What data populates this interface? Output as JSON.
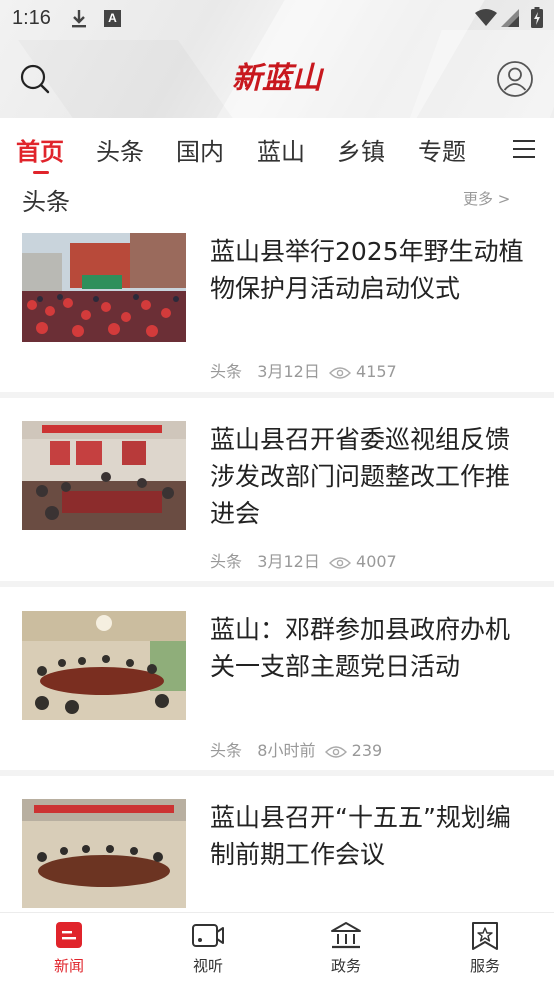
{
  "status_bar": {
    "time": "1:16",
    "a_badge": "A"
  },
  "header": {
    "logo_text": "新蓝山"
  },
  "tabs": [
    {
      "label": "首页",
      "active": true
    },
    {
      "label": "头条"
    },
    {
      "label": "国内"
    },
    {
      "label": "蓝山"
    },
    {
      "label": "乡镇"
    },
    {
      "label": "专题"
    }
  ],
  "section": {
    "title": "头条",
    "more": "更多 >"
  },
  "news": [
    {
      "title": "蓝山县举行2025年野生动植物保护月活动启动仪式",
      "category": "头条",
      "date": "3月12日",
      "views": "4157"
    },
    {
      "title": "蓝山县召开省委巡视组反馈涉发改部门问题整改工作推进会",
      "category": "头条",
      "date": "3月12日",
      "views": "4007"
    },
    {
      "title": "蓝山：邓群参加县政府办机关一支部主题党日活动",
      "category": "头条",
      "date": "8小时前",
      "views": "239"
    },
    {
      "title": "蓝山县召开“十五五”规划编制前期工作会议",
      "category": "",
      "date": "",
      "views": ""
    }
  ],
  "bottom_nav": [
    {
      "label": "新闻",
      "icon": "news-icon",
      "active": true
    },
    {
      "label": "视听",
      "icon": "video-icon"
    },
    {
      "label": "政务",
      "icon": "government-icon"
    },
    {
      "label": "服务",
      "icon": "service-icon"
    }
  ],
  "colors": {
    "accent": "#e0242b",
    "meta": "#999999"
  }
}
